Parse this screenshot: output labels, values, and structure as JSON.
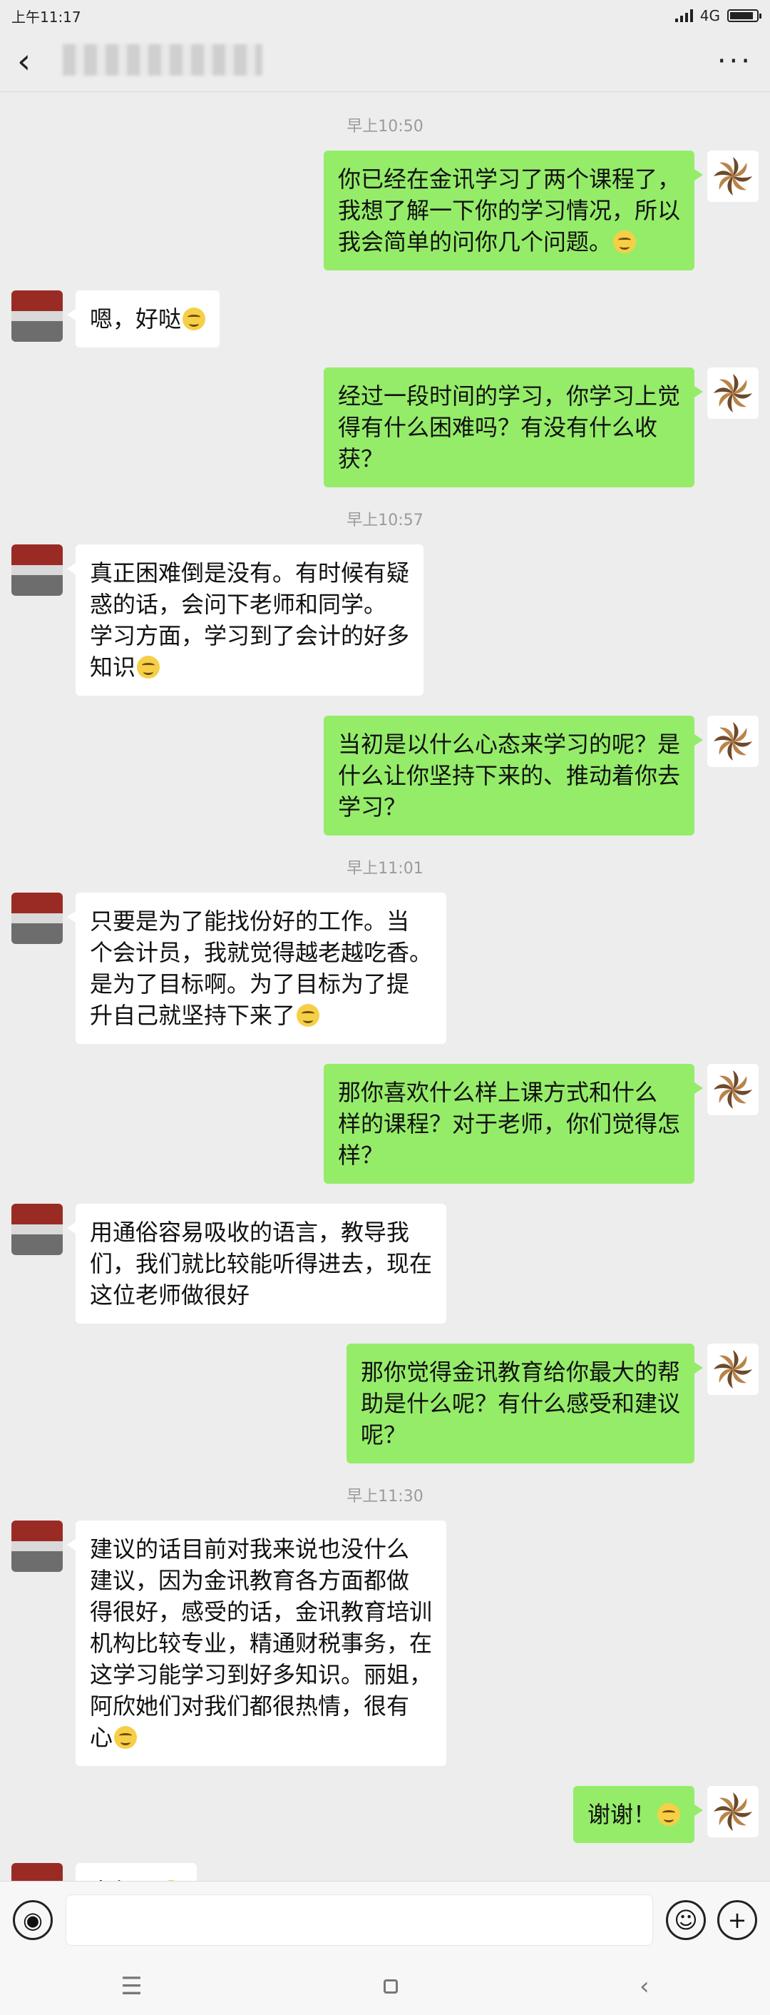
{
  "status_bar": {
    "time": "上午11:17",
    "network": "4G",
    "battery_level": 0.9
  },
  "header": {
    "back_icon": "chevron-left-icon",
    "more_label": "···"
  },
  "messages": [
    {
      "type": "time",
      "text": "早上10:50"
    },
    {
      "side": "right",
      "lines": [
        "你已经在金讯学习了两个课程了，",
        "我想了解一下你的学习情况，所以",
        "我会简单的问你几个问题。"
      ],
      "emoji": true
    },
    {
      "side": "left",
      "lines": [
        "嗯，好哒"
      ],
      "emoji": true
    },
    {
      "side": "right",
      "lines": [
        "经过一段时间的学习，你学习上觉",
        "得有什么困难吗？有没有什么收",
        "获？"
      ],
      "emoji": false
    },
    {
      "type": "time",
      "text": "早上10:57"
    },
    {
      "side": "left",
      "lines": [
        "真正困难倒是没有。有时候有疑",
        "惑的话，会问下老师和同学。",
        "学习方面，学习到了会计的好多",
        "知识"
      ],
      "emoji": true
    },
    {
      "side": "right",
      "lines": [
        "当初是以什么心态来学习的呢？是",
        "什么让你坚持下来的、推动着你去",
        "学习？"
      ],
      "emoji": false
    },
    {
      "type": "time",
      "text": "早上11:01"
    },
    {
      "side": "left",
      "lines": [
        "只要是为了能找份好的工作。当",
        "个会计员，我就觉得越老越吃香。",
        "是为了目标啊。为了目标为了提",
        "升自己就坚持下来了"
      ],
      "emoji": true
    },
    {
      "side": "right",
      "lines": [
        "那你喜欢什么样上课方式和什么",
        "样的课程？对于老师，你们觉得怎",
        "样？"
      ],
      "emoji": false
    },
    {
      "side": "left",
      "lines": [
        "用通俗容易吸收的语言，教导我",
        "们，我们就比较能听得进去，现在",
        "这位老师做很好"
      ],
      "emoji": false
    },
    {
      "side": "right",
      "lines": [
        "那你觉得金讯教育给你最大的帮",
        "助是什么呢？有什么感受和建议",
        "呢？"
      ],
      "emoji": false
    },
    {
      "type": "time",
      "text": "早上11:30"
    },
    {
      "side": "left",
      "lines": [
        "建议的话目前对我来说也没什么",
        "建议，因为金讯教育各方面都做",
        "得很好，感受的话，金讯教育培训",
        "机构比较专业，精通财税事务，在",
        "这学习能学习到好多知识。丽姐，",
        "阿欣她们对我们都很热情，很有",
        "心"
      ],
      "emoji": true
    },
    {
      "side": "right",
      "lines": [
        "谢谢！"
      ],
      "emoji": true
    },
    {
      "side": "left",
      "lines": [
        "客气了"
      ],
      "emoji": true
    }
  ],
  "input_bar": {
    "voice_icon": "voice-icon",
    "emoji_icon": "emoji-icon",
    "plus_icon": "plus-icon",
    "plus_label": "+"
  },
  "system_nav": {
    "menu_label": "☰",
    "back_label": "‹"
  }
}
